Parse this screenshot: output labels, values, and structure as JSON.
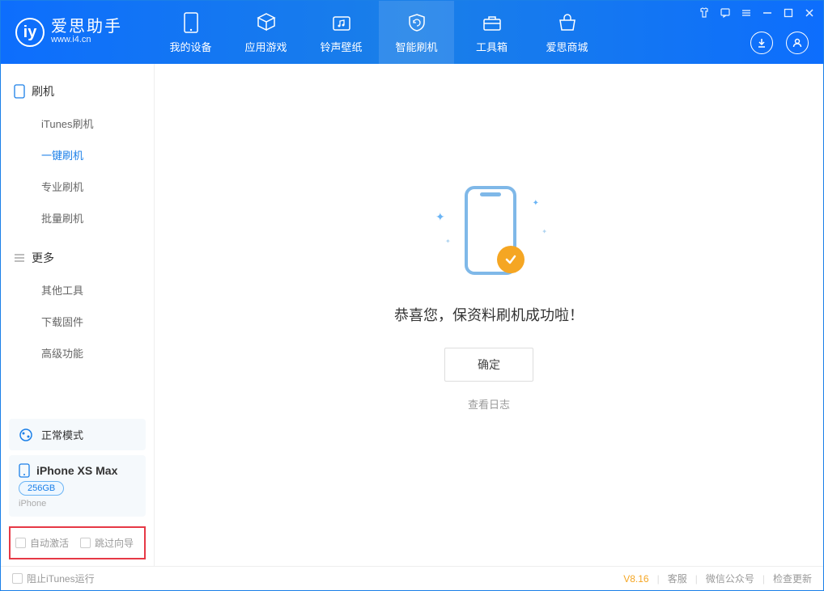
{
  "app": {
    "title": "爱思助手",
    "subtitle": "www.i4.cn"
  },
  "nav": {
    "my_device": "我的设备",
    "apps_games": "应用游戏",
    "ring_wallpaper": "铃声壁纸",
    "smart_flash": "智能刷机",
    "toolbox": "工具箱",
    "store": "爱思商城"
  },
  "sidebar": {
    "group1": "刷机",
    "items1": [
      "iTunes刷机",
      "一键刷机",
      "专业刷机",
      "批量刷机"
    ],
    "group2": "更多",
    "items2": [
      "其他工具",
      "下载固件",
      "高级功能"
    ]
  },
  "device": {
    "mode": "正常模式",
    "name": "iPhone XS Max",
    "storage": "256GB",
    "type": "iPhone"
  },
  "checkboxes": {
    "auto_activate": "自动激活",
    "skip_guide": "跳过向导"
  },
  "main": {
    "success": "恭喜您，保资料刷机成功啦！",
    "ok": "确定",
    "view_log": "查看日志"
  },
  "footer": {
    "block_itunes": "阻止iTunes运行",
    "version": "V8.16",
    "support": "客服",
    "wechat": "微信公众号",
    "check_update": "检查更新"
  }
}
